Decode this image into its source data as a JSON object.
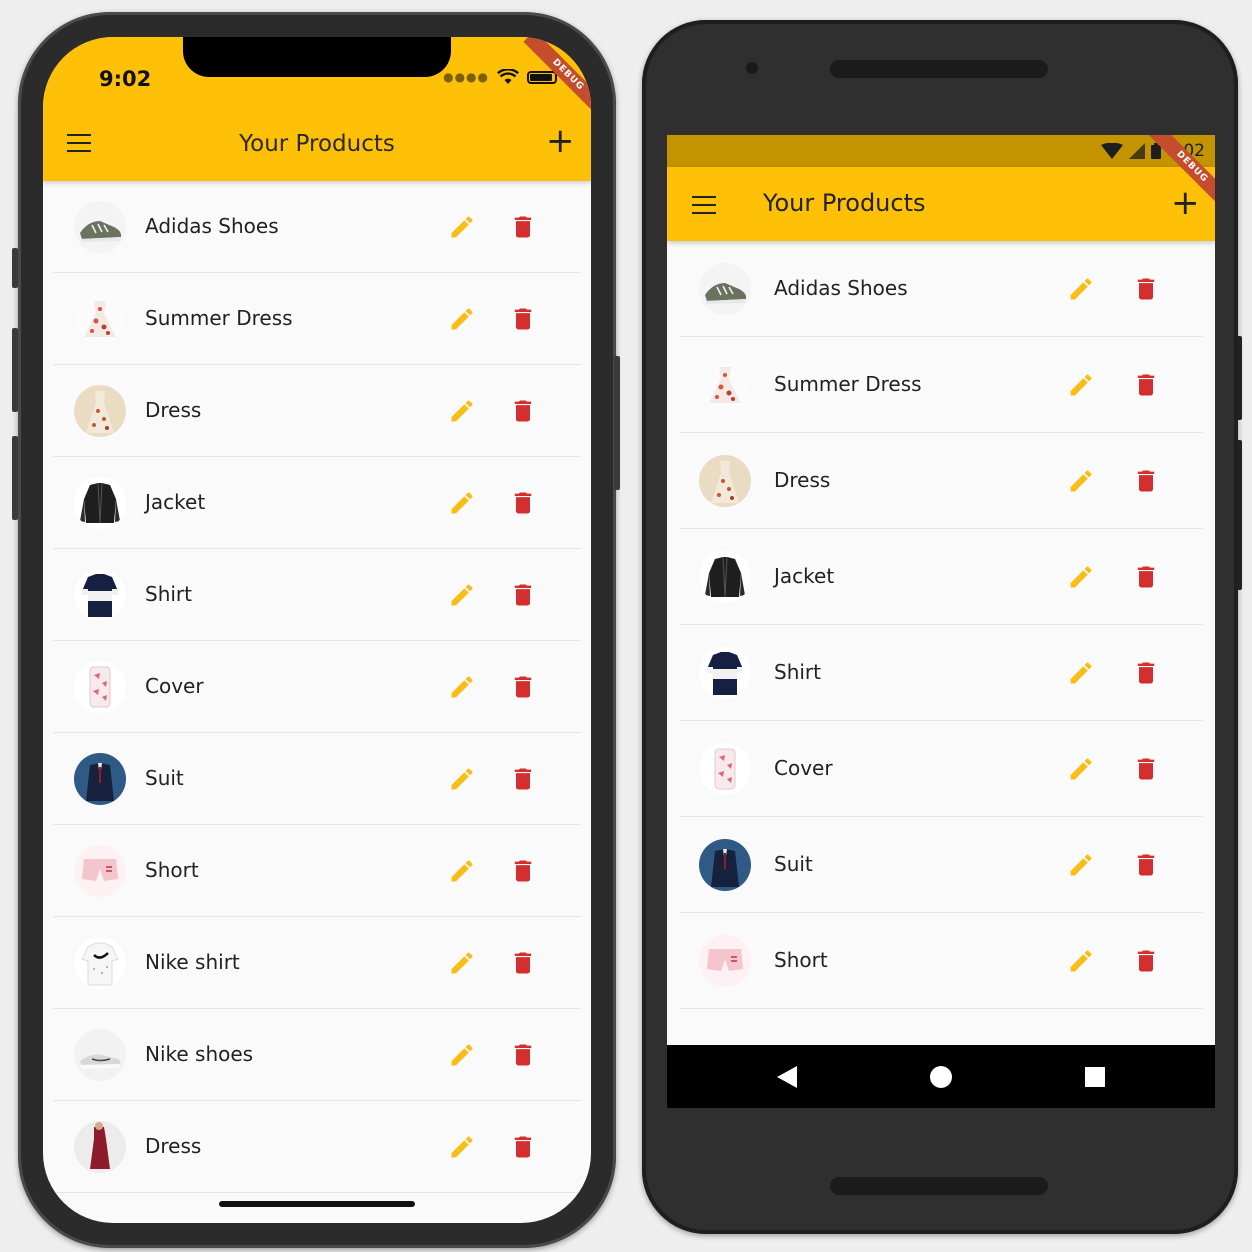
{
  "colors": {
    "accent": "#ffc107",
    "edit": "#f9bd17",
    "delete": "#d32f2f"
  },
  "ios": {
    "status_time": "9:02",
    "title": "Your Products",
    "debug_label": "DEBUG",
    "products": [
      {
        "name": "Adidas Shoes",
        "thumb": "sneaker"
      },
      {
        "name": "Summer Dress",
        "thumb": "floral-dress"
      },
      {
        "name": "Dress",
        "thumb": "beige-dress"
      },
      {
        "name": "Jacket",
        "thumb": "leather-jacket"
      },
      {
        "name": "Shirt",
        "thumb": "navy-shirt"
      },
      {
        "name": "Cover",
        "thumb": "phone-cover"
      },
      {
        "name": "Suit",
        "thumb": "suit"
      },
      {
        "name": "Short",
        "thumb": "pink-short"
      },
      {
        "name": "Nike shirt",
        "thumb": "nike-shirt"
      },
      {
        "name": "Nike shoes",
        "thumb": "nike-shoes"
      },
      {
        "name": "Dress",
        "thumb": "red-dress"
      }
    ]
  },
  "android": {
    "status_time": "9:02",
    "title": "Your Products",
    "debug_label": "DEBUG",
    "products": [
      {
        "name": "Adidas Shoes",
        "thumb": "sneaker"
      },
      {
        "name": "Summer Dress",
        "thumb": "floral-dress"
      },
      {
        "name": "Dress",
        "thumb": "beige-dress"
      },
      {
        "name": "Jacket",
        "thumb": "leather-jacket"
      },
      {
        "name": "Shirt",
        "thumb": "navy-shirt"
      },
      {
        "name": "Cover",
        "thumb": "phone-cover"
      },
      {
        "name": "Suit",
        "thumb": "suit"
      },
      {
        "name": "Short",
        "thumb": "pink-short"
      }
    ]
  }
}
